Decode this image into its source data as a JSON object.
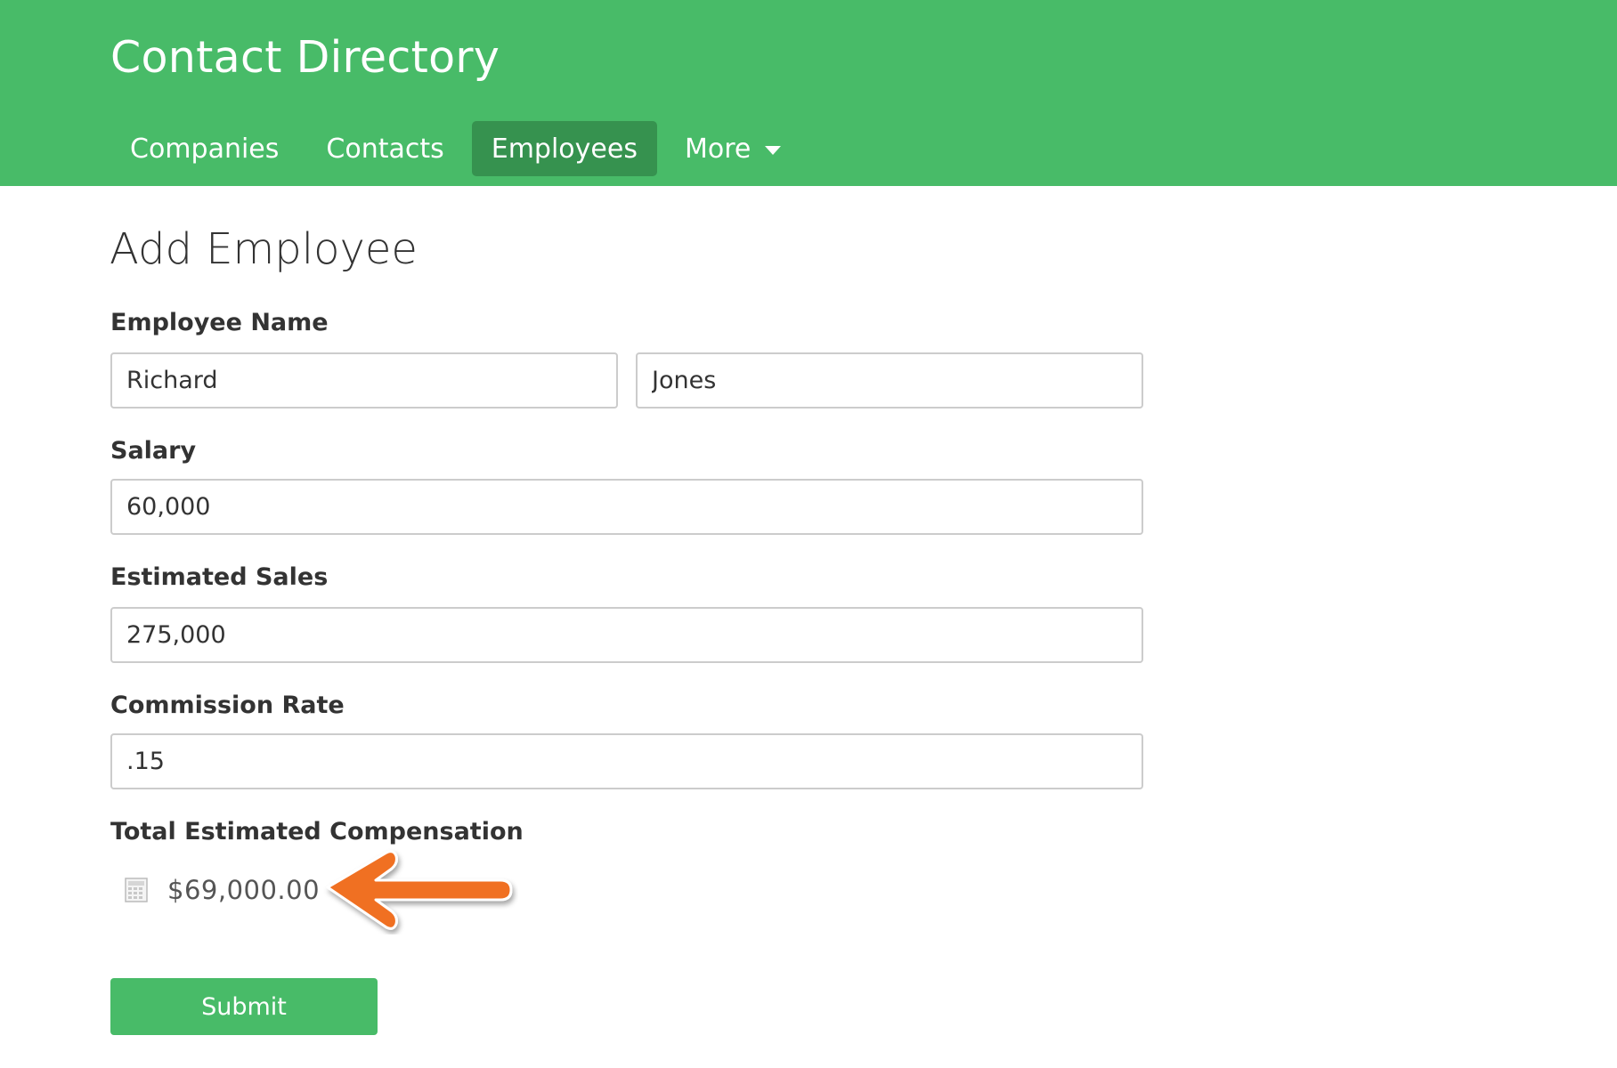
{
  "header": {
    "app_title": "Contact Directory",
    "accent_color": "#48bb68",
    "nav": [
      {
        "label": "Companies",
        "active": false
      },
      {
        "label": "Contacts",
        "active": false
      },
      {
        "label": "Employees",
        "active": true
      },
      {
        "label": "More",
        "active": false,
        "icon": "caret-down-icon"
      }
    ]
  },
  "form": {
    "title": "Add Employee",
    "employee_name": {
      "label": "Employee Name",
      "first_name": "Richard",
      "last_name": "Jones"
    },
    "salary": {
      "label": "Salary",
      "value": "60,000"
    },
    "estimated_sales": {
      "label": "Estimated Sales",
      "value": "275,000"
    },
    "commission_rate": {
      "label": "Commission Rate",
      "value": ".15"
    },
    "total_compensation": {
      "label": "Total Estimated Compensation",
      "value": "$69,000.00",
      "icon": "calculator-icon"
    },
    "submit_label": "Submit"
  },
  "annotation": {
    "icon": "arrow-left-icon",
    "color": "#f07024"
  }
}
